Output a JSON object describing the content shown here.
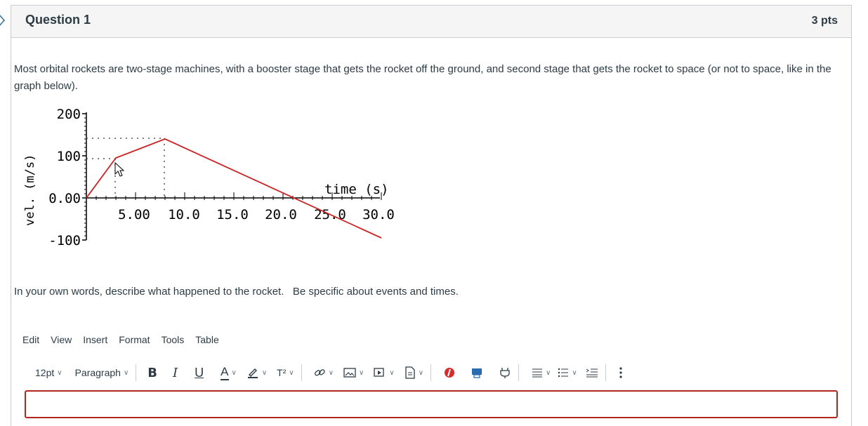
{
  "question": {
    "title": "Question 1",
    "points": "3 pts",
    "text": "Most orbital rockets are two-stage machines, with a booster stage that gets the rocket off the ground, and second stage that gets the rocket to space (or not to space, like in the graph below).",
    "prompt": "In your own words, describe what happened to the rocket.   Be specific about events and times."
  },
  "graph": {
    "ylabel": "vel. (m/s)",
    "xlabel": "time (s)",
    "y_ticks": [
      "200",
      "100",
      "0.00",
      "-100"
    ],
    "x_ticks": [
      "5.00",
      "10.0",
      "15.0",
      "20.0",
      "25.0",
      "30.0"
    ],
    "line_color": "#cc2222"
  },
  "chart_data": {
    "type": "line",
    "xlabel": "time (s)",
    "ylabel": "vel. (m/s)",
    "x": [
      0,
      3,
      8,
      30
    ],
    "y": [
      0,
      95,
      140,
      -95
    ],
    "xlim": [
      0,
      30
    ],
    "ylim": [
      -100,
      200
    ]
  },
  "editor": {
    "menus": [
      "Edit",
      "View",
      "Insert",
      "Format",
      "Tools",
      "Table"
    ],
    "font_size": "12pt",
    "block_format": "Paragraph",
    "bold": "B",
    "italic": "I",
    "underline": "U",
    "text_color": "A",
    "superscript": "T²"
  }
}
